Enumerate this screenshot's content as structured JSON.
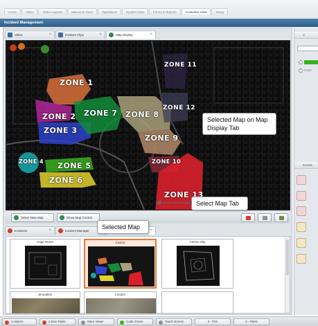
{
  "menu": {
    "tabs": [
      "Home",
      "Video",
      "Video Layouts",
      "Macros & Tours",
      "Operations",
      "System Data",
      "Forms & Reports",
      "Customer View",
      "Setup"
    ],
    "active_index": 7
  },
  "window": {
    "title": "Incident Management"
  },
  "top_tabs": [
    {
      "label": "Video",
      "icon": "video-icon",
      "color": "#3d6da3"
    },
    {
      "label": "Incident Clips",
      "icon": "film-icon",
      "color": "#3d6da3"
    },
    {
      "label": "Map Display",
      "icon": "globe-icon",
      "color": "#2b8a5a"
    }
  ],
  "map": {
    "zones": [
      {
        "name": "ZONE 1",
        "color": "#d9703a"
      },
      {
        "name": "ZONE 2",
        "color": "#b0279a"
      },
      {
        "name": "ZONE 3",
        "color": "#2c43c9"
      },
      {
        "name": "ZONE 4",
        "color": "#1aa3a8"
      },
      {
        "name": "ZONE 5",
        "color": "#3ab01e"
      },
      {
        "name": "ZONE 6",
        "color": "#e2d12a"
      },
      {
        "name": "ZONE 7",
        "color": "#138c3b"
      },
      {
        "name": "ZONE 8",
        "color": "#a9a07a"
      },
      {
        "name": "ZONE 9",
        "color": "#b48a68"
      },
      {
        "name": "ZONE 10",
        "color": "#8a2a3a"
      },
      {
        "name": "ZONE 11",
        "color": "#2a2340"
      },
      {
        "name": "ZONE 12",
        "color": "#3e3e55"
      },
      {
        "name": "ZONE 13",
        "color": "#d8202c"
      }
    ]
  },
  "map_toolbar": {
    "select_new_map": "Select New Map",
    "show_map_control": "Show Map Control"
  },
  "bottom_tabs": [
    {
      "label": "Incidents",
      "icon": "alert-icon",
      "color": "#d63b2a"
    },
    {
      "label": "Incident Manager",
      "icon": "alert-icon",
      "color": "#d63b2a"
    },
    {
      "label": "Select Map",
      "icon": "globe-icon",
      "color": "#2b8a5a"
    }
  ],
  "maps": [
    {
      "label": "Cage Room"
    },
    {
      "label": "Casino"
    },
    {
      "label": "Casino Sky"
    },
    {
      "label": "Jerusalem"
    },
    {
      "label": "London"
    }
  ],
  "callouts": {
    "map_display": "Selected Map on Map Display Tab",
    "select_map_tab": "Select Map Tab",
    "selected_map": "Selected Map"
  },
  "right_panel": {
    "header1": "V",
    "radio2": "Contr",
    "header2": "Events"
  },
  "statusbar": {
    "alarms": "3 Alarms",
    "due_tasks": "4 Due Tasks",
    "more_views": "More Views",
    "code_green": "Code Green",
    "touch_screen": "Touch Screen",
    "fire": "2 - Fire",
    "panic": "3 - Panic"
  }
}
